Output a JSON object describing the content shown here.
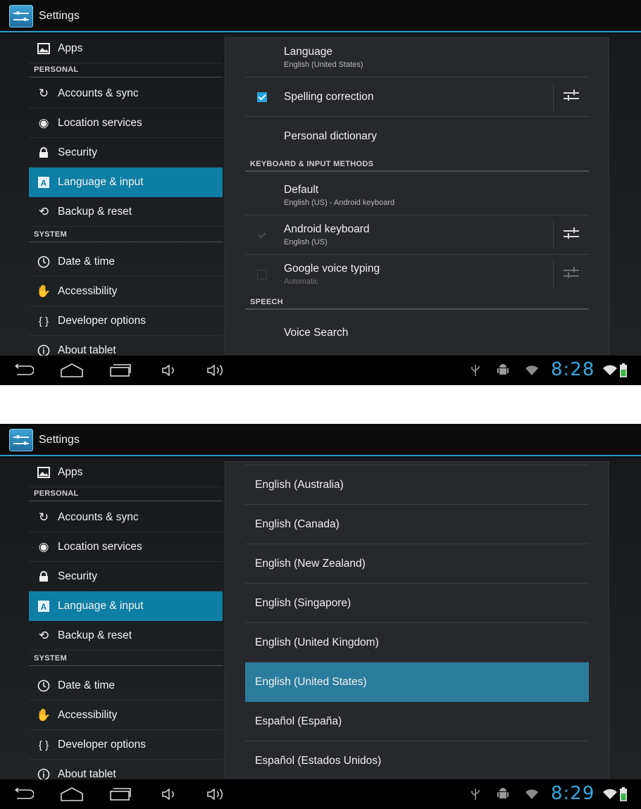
{
  "screens": [
    {
      "action_bar": {
        "title": "Settings"
      },
      "sidebar": {
        "rows": [
          {
            "type": "item",
            "label": "Apps",
            "icon": "apps-icon",
            "active": false
          },
          {
            "type": "header",
            "label": "PERSONAL"
          },
          {
            "type": "item",
            "label": "Accounts & sync",
            "icon": "sync-icon",
            "active": false
          },
          {
            "type": "item",
            "label": "Location services",
            "icon": "location-icon",
            "active": false
          },
          {
            "type": "item",
            "label": "Security",
            "icon": "lock-icon",
            "active": false
          },
          {
            "type": "item",
            "label": "Language & input",
            "icon": "language-icon",
            "active": true
          },
          {
            "type": "item",
            "label": "Backup & reset",
            "icon": "backup-icon",
            "active": false
          },
          {
            "type": "header",
            "label": "SYSTEM"
          },
          {
            "type": "item",
            "label": "Date & time",
            "icon": "clock-icon",
            "active": false
          },
          {
            "type": "item",
            "label": "Accessibility",
            "icon": "hand-icon",
            "active": false
          },
          {
            "type": "item",
            "label": "Developer options",
            "icon": "braces-icon",
            "active": false
          },
          {
            "type": "item",
            "label": "About tablet",
            "icon": "info-icon",
            "active": false
          }
        ]
      },
      "panel": {
        "rows": [
          {
            "title": "Language",
            "subtitle": "English (United States)",
            "checkbox": "none",
            "settings": false
          },
          {
            "title": "Spelling correction",
            "subtitle": "",
            "checkbox": "checked",
            "settings": true
          },
          {
            "title": "Personal dictionary",
            "subtitle": "",
            "checkbox": "none",
            "settings": false
          },
          {
            "header": "KEYBOARD & INPUT METHODS"
          },
          {
            "title": "Default",
            "subtitle": "English (US) - Android keyboard",
            "checkbox": "none",
            "settings": false
          },
          {
            "title": "Android keyboard",
            "subtitle": "English (US)",
            "checkbox": "disabled-checked",
            "settings": true
          },
          {
            "title": "Google voice typing",
            "subtitle": "Automatic",
            "checkbox": "unchecked",
            "settings": "dim"
          },
          {
            "header": "SPEECH"
          },
          {
            "title": "Voice Search",
            "subtitle": "",
            "checkbox": "none",
            "settings": false
          }
        ]
      },
      "status": {
        "time": "8:28"
      }
    },
    {
      "action_bar": {
        "title": "Settings"
      },
      "sidebar": {
        "rows": [
          {
            "type": "item",
            "label": "Apps",
            "icon": "apps-icon",
            "active": false
          },
          {
            "type": "header",
            "label": "PERSONAL"
          },
          {
            "type": "item",
            "label": "Accounts & sync",
            "icon": "sync-icon",
            "active": false
          },
          {
            "type": "item",
            "label": "Location services",
            "icon": "location-icon",
            "active": false
          },
          {
            "type": "item",
            "label": "Security",
            "icon": "lock-icon",
            "active": false
          },
          {
            "type": "item",
            "label": "Language & input",
            "icon": "language-icon",
            "active": true
          },
          {
            "type": "item",
            "label": "Backup & reset",
            "icon": "backup-icon",
            "active": false
          },
          {
            "type": "header",
            "label": "SYSTEM"
          },
          {
            "type": "item",
            "label": "Date & time",
            "icon": "clock-icon",
            "active": false
          },
          {
            "type": "item",
            "label": "Accessibility",
            "icon": "hand-icon",
            "active": false
          },
          {
            "type": "item",
            "label": "Developer options",
            "icon": "braces-icon",
            "active": false
          },
          {
            "type": "item",
            "label": "About tablet",
            "icon": "info-icon",
            "active": false
          }
        ]
      },
      "language_list": [
        {
          "label": "English (Australia)",
          "selected": false
        },
        {
          "label": "English (Canada)",
          "selected": false
        },
        {
          "label": "English (New Zealand)",
          "selected": false
        },
        {
          "label": "English (Singapore)",
          "selected": false
        },
        {
          "label": "English (United Kingdom)",
          "selected": false
        },
        {
          "label": "English (United States)",
          "selected": true
        },
        {
          "label": "Español (España)",
          "selected": false
        },
        {
          "label": "Español (Estados Unidos)",
          "selected": false
        }
      ],
      "status": {
        "time": "8:29"
      }
    }
  ],
  "colors": {
    "accent": "#2f9bcc",
    "active_item": "#0e7ea5",
    "selected_row": "#2b7c9c",
    "clock": "#37a9df"
  }
}
